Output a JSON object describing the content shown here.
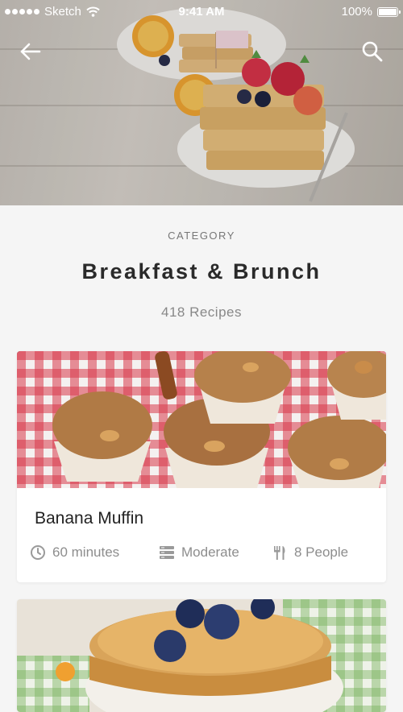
{
  "status_bar": {
    "carrier": "Sketch",
    "time": "9:41 AM",
    "battery": "100%",
    "battery_level": 1.0
  },
  "nav": {
    "back_icon": "arrow-left-icon",
    "search_icon": "search-icon"
  },
  "category": {
    "label": "CATEGORY",
    "title": "Breakfast & Brunch",
    "count": "418 Recipes"
  },
  "recipes": [
    {
      "title": "Banana Muffin",
      "time": "60 minutes",
      "difficulty": "Moderate",
      "servings": "8 People",
      "icons": [
        "clock-icon",
        "difficulty-bars-icon",
        "fork-knife-icon"
      ]
    },
    {
      "image": "pancakes-with-blueberries"
    }
  ],
  "colors": {
    "background": "#f5f5f5",
    "card": "#ffffff",
    "title_text": "#2a2a2a",
    "muted_text": "#8d8d8d"
  }
}
